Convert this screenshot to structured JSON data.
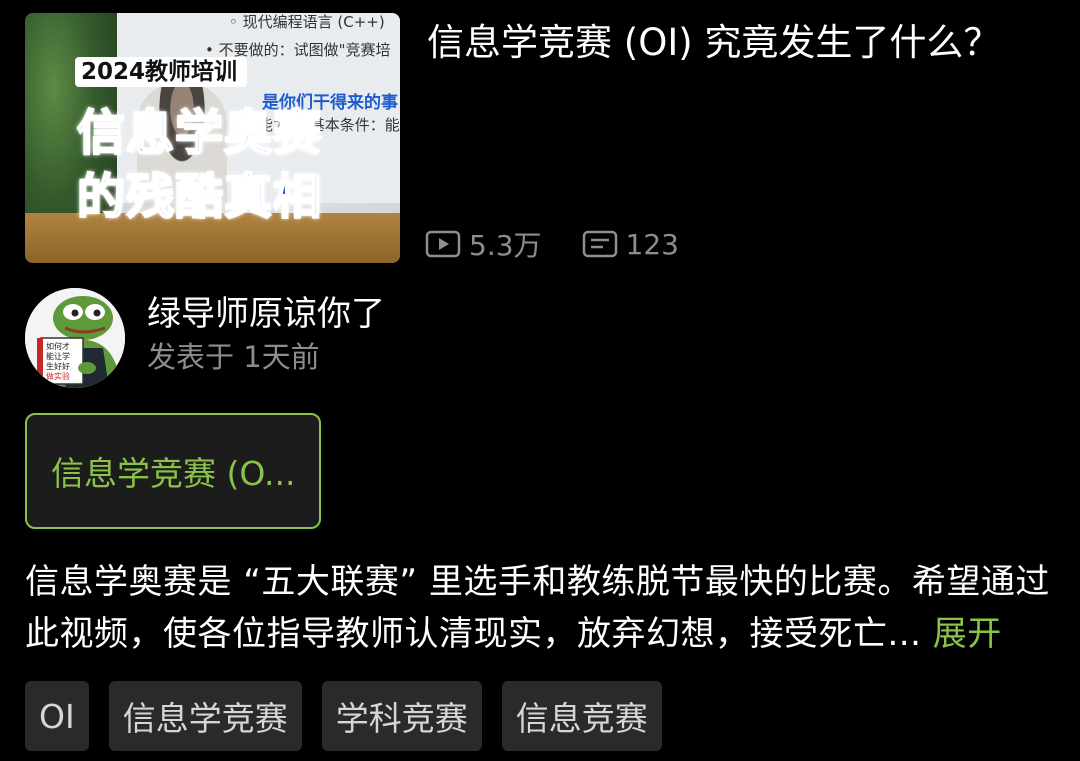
{
  "video": {
    "thumbnail": {
      "badge": "2024教师培训",
      "title_line1": "信息学奥赛",
      "title_line2": "的残酷真相",
      "screen_line1": "◦ 现代编程语言 (C++)",
      "screen_line2": "• 不要做的：试图做\"竞赛培",
      "screen_line3": "是你们干得来的事",
      "screen_line4": "\"能力\"的基本条件：能"
    },
    "title": "信息学竞赛 (OI) 究竟发生了什么？",
    "views": "5.3万",
    "comments": "123"
  },
  "author": {
    "name": "绿导师原谅你了",
    "post_time": "发表于 1天前",
    "avatar_book_text": [
      "如何才",
      "能让学",
      "生好好",
      "做实验"
    ]
  },
  "collection": {
    "label": "信息学竞赛 (O..."
  },
  "description": {
    "line1": "信息学奥赛是 “五大联赛” 里选手和教练脱节最快的比赛。希望通过",
    "line2": "此视频，使各位指导教师认清现实，放弃幻想，接受死亡...",
    "expand_label": "展开"
  },
  "tags": [
    "OI",
    "信息学竞赛",
    "学科竞赛",
    "信息竞赛"
  ],
  "colors": {
    "accent": "#8bc34a",
    "muted": "#8d8d8d",
    "background": "#000000",
    "tag_bg": "#2a2a2a"
  },
  "icons": {
    "views": "play-count-icon",
    "comments": "comment-count-icon"
  }
}
